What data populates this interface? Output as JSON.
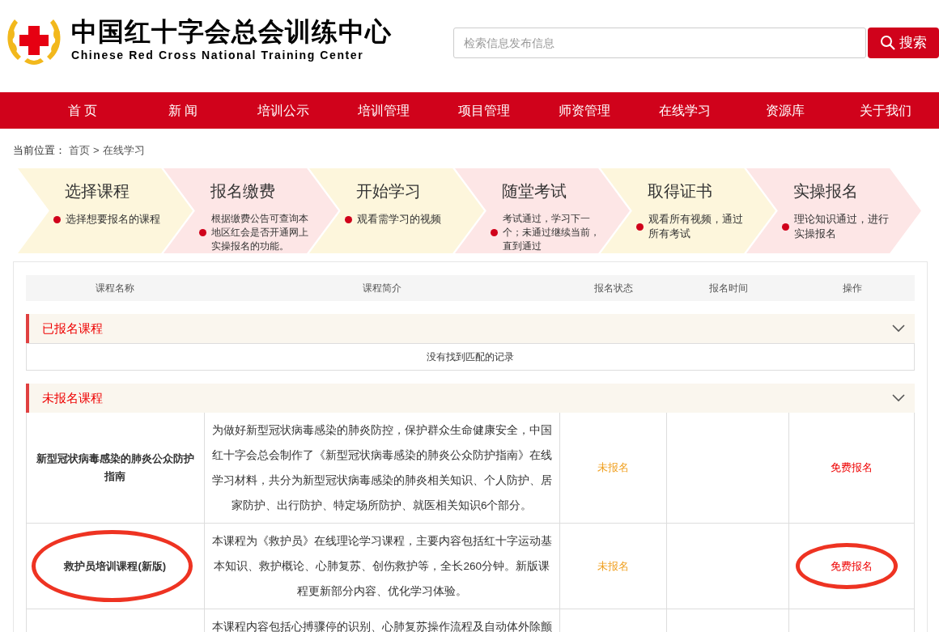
{
  "header": {
    "logo_title": "中国红十字会总会训练中心",
    "logo_subtitle": "Chinese Red Cross National Training Center",
    "search": {
      "placeholder": "检索信息发布信息"
    },
    "search_button": "搜索"
  },
  "nav": [
    {
      "label": "首 页"
    },
    {
      "label": "新 闻"
    },
    {
      "label": "培训公示"
    },
    {
      "label": "培训管理"
    },
    {
      "label": "项目管理"
    },
    {
      "label": "师资管理"
    },
    {
      "label": "在线学习"
    },
    {
      "label": "资源库"
    },
    {
      "label": "关于我们"
    }
  ],
  "breadcrumb": {
    "label": "当前位置：",
    "items": [
      "首页",
      ">",
      "在线学习"
    ]
  },
  "steps": [
    {
      "title": "选择课程",
      "text": "选择想要报名的课程",
      "color": "#fdf6dc"
    },
    {
      "title": "报名缴费",
      "text": "根据缴费公告可查询本地区红会是否开通网上实操报名的功能。",
      "color": "#fde6e6"
    },
    {
      "title": "开始学习",
      "text": "观看需学习的视频",
      "color": "#fdf6dc"
    },
    {
      "title": "随堂考试",
      "text": "考试通过，学习下一个；未通过继续当前，直到通过",
      "color": "#fde6e6"
    },
    {
      "title": "取得证书",
      "text": "观看所有视频，通过所有考试",
      "color": "#fdf6dc"
    },
    {
      "title": "实操报名",
      "text": "理论知识通过，进行实操报名",
      "color": "#fde6e6"
    }
  ],
  "table": {
    "columns": [
      "课程名称",
      "课程简介",
      "报名状态",
      "报名时间",
      "操作"
    ],
    "sections": [
      {
        "title": "已报名课程",
        "expanded": true,
        "empty_text": "没有找到匹配的记录"
      },
      {
        "title": "未报名课程",
        "expanded": true,
        "rows": [
          {
            "name": "新型冠状病毒感染的肺炎公众防护指南",
            "description": "为做好新型冠状病毒感染的肺炎防控，保护群众生命健康安全，中国红十字会总会制作了《新型冠状病毒感染的肺炎公众防护指南》在线学习材料，共分为新型冠状病毒感染的肺炎相关知识、个人防护、居家防护、出行防护、特定场所防护、就医相关知识6个部分。",
            "status": "未报名",
            "action": "免费报名",
            "circled": false
          },
          {
            "name": "救护员培训课程(新版)",
            "description": "本课程为《救护员》在线理论学习课程，主要内容包括红十字运动基本知识、救护概论、心肺复苏、创伤救护等，全长260分钟。新版课程更新部分内容、优化学习体验。",
            "status": "未报名",
            "action": "免费报名",
            "circled": true
          },
          {
            "description": "本课程内容包括心搏骤停的识别、心肺复苏操作流程及自动体外除颤"
          }
        ]
      }
    ]
  }
}
